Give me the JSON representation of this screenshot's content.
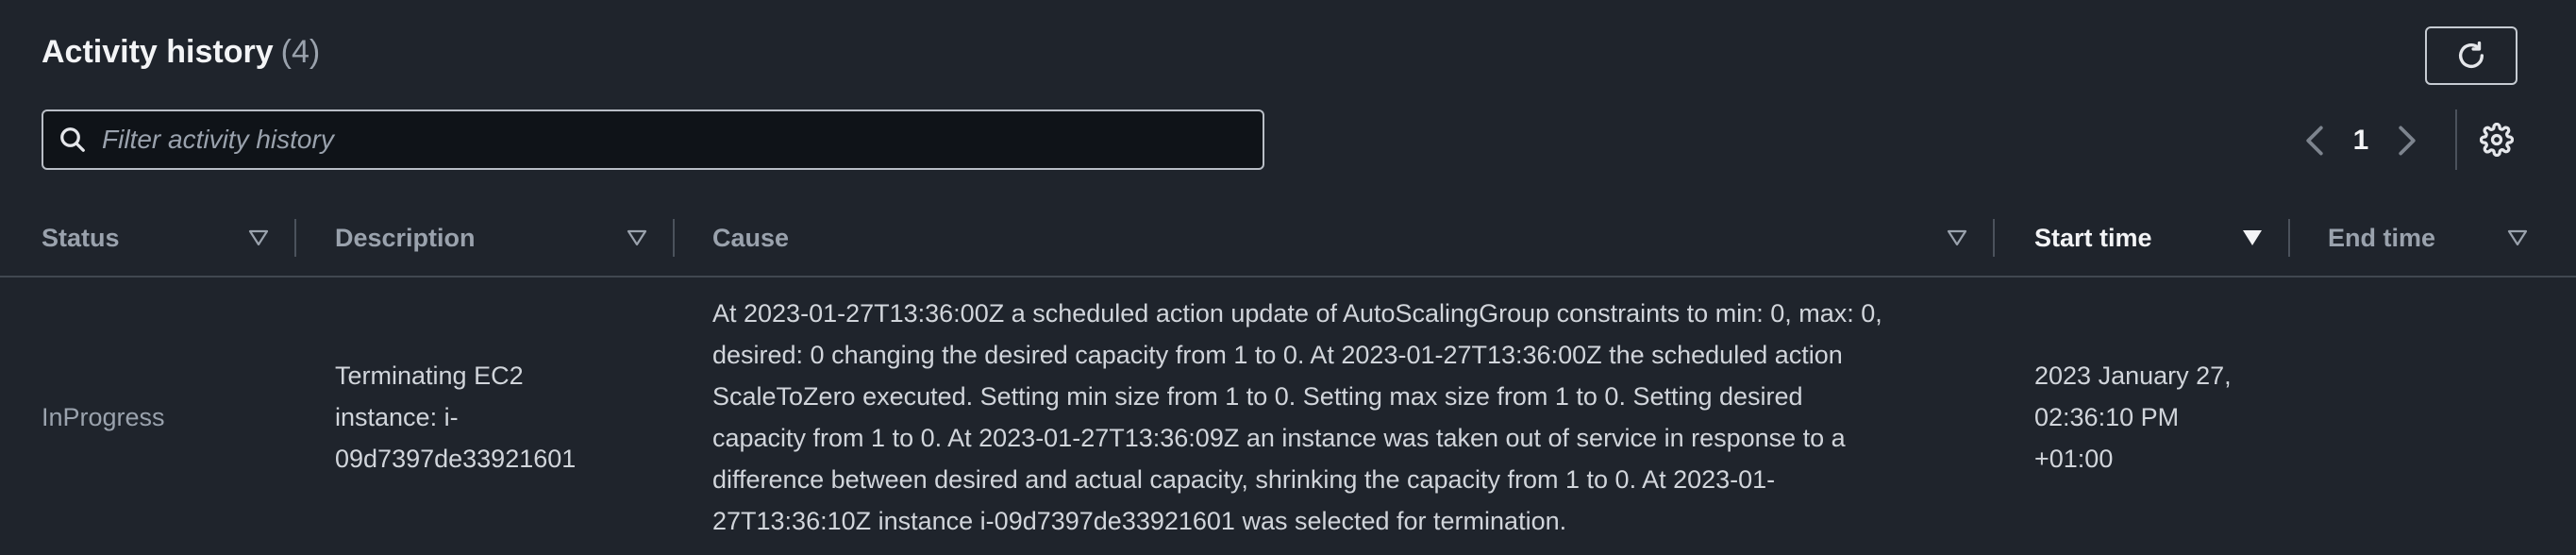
{
  "header": {
    "title": "Activity history",
    "count": "(4)"
  },
  "search": {
    "placeholder": "Filter activity history",
    "value": ""
  },
  "pagination": {
    "current_page": "1"
  },
  "table": {
    "columns": [
      "Status",
      "Description",
      "Cause",
      "Start time",
      "End time"
    ],
    "sorted_column": "Start time",
    "rows": [
      {
        "status": "InProgress",
        "description_lines": [
          "Terminating EC2",
          "instance: i-",
          "09d7397de33921601"
        ],
        "cause_lines": [
          "At 2023-01-27T13:36:00Z a scheduled action update of AutoScalingGroup constraints to min: 0, max: 0,",
          "desired: 0 changing the desired capacity from 1 to 0. At 2023-01-27T13:36:00Z the scheduled action",
          "ScaleToZero executed. Setting min size from 1 to 0. Setting max size from 1 to 0. Setting desired",
          "capacity from 1 to 0. At 2023-01-27T13:36:09Z an instance was taken out of service in response to a",
          "difference between desired and actual capacity, shrinking the capacity from 1 to 0. At 2023-01-",
          "27T13:36:10Z instance i-09d7397de33921601 was selected for termination."
        ],
        "start_time_lines": [
          "2023 January 27,",
          "02:36:10 PM",
          "+01:00"
        ],
        "end_time": ""
      }
    ]
  },
  "icons": {
    "refresh": "refresh-icon",
    "search": "search-icon",
    "prev": "chevron-left-icon",
    "next": "chevron-right-icon",
    "settings": "gear-icon",
    "sort": "caret-down-icon"
  },
  "colors": {
    "background": "#1f242c",
    "input_background": "#0f1318",
    "muted_text": "#9aa2ad",
    "bright_text": "#f3f4f6"
  }
}
